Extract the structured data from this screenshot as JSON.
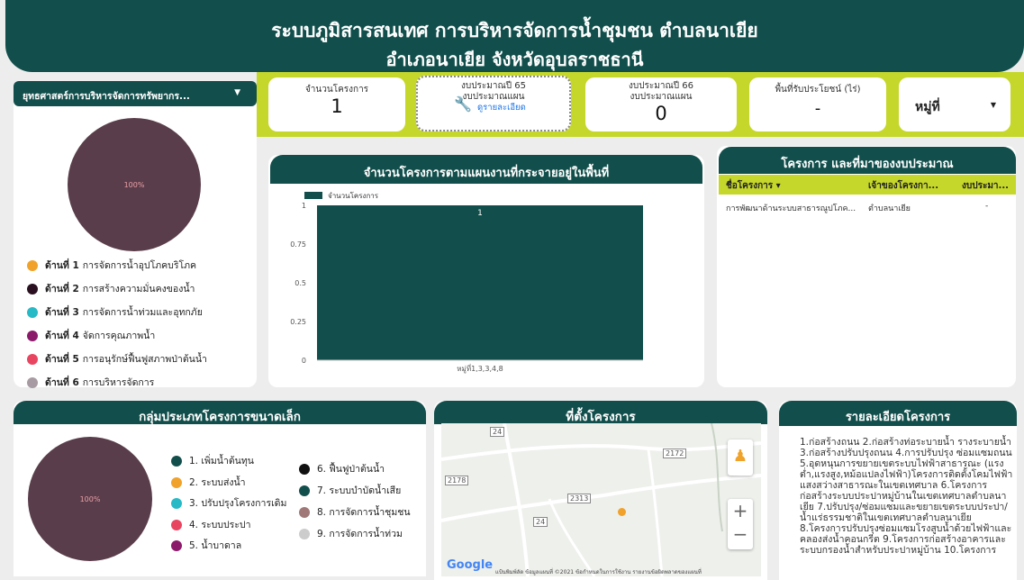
{
  "header": {
    "title_line1": "ระบบภูมิสารสนเทศ การบริหารจัดการน้ำชุมชน ตำบลนาเยีย",
    "title_line2": "อำเภอนาเยีย จังหวัดอุบลราชธานี"
  },
  "strategy_dropdown": {
    "label": "ยุทธศาสตร์การบริหารจัดการทรัพยากร..."
  },
  "kpis": {
    "project_count": {
      "label": "จำนวนโครงการ",
      "value": "1"
    },
    "budget65": {
      "label_line1": "งบประมาณปี 65",
      "label_line2": "งบประมาณแผน",
      "link": "ดูรายละเอียด"
    },
    "budget66": {
      "label_line1": "งบประมาณปี 66",
      "label_line2": "งบประมาณแผน",
      "value": "0"
    },
    "area": {
      "label": "พื้นที่รับประโยชน์ (ไร่)",
      "value": "-"
    },
    "village": {
      "label": "หมู่ที่"
    }
  },
  "pie1": {
    "label": "100%",
    "color": "#5a3d4a"
  },
  "strategy_legend": [
    {
      "bold": "ด้านที่ 1",
      "text": "การจัดการน้ำอุปโภคบริโภค",
      "color": "#f0a22a"
    },
    {
      "bold": "ด้านที่ 2",
      "text": "การสร้างความมั่นคงของน้ำ",
      "color": "#2a1020"
    },
    {
      "bold": "ด้านที่ 3",
      "text": "การจัดการน้ำท่วมและอุทกภัย",
      "color": "#26b9c6"
    },
    {
      "bold": "ด้านที่ 4",
      "text": "จัดการคุณภาพน้ำ",
      "color": "#8c1a6a"
    },
    {
      "bold": "ด้านที่ 5",
      "text": "การอนุรักษ์ฟื้นฟูสภาพป่าต้นน้ำ",
      "color": "#e84560"
    },
    {
      "bold": "ด้านที่ 6",
      "text": "การบริหารจัดการ",
      "color": "#a89aa2"
    }
  ],
  "bar_panel": {
    "title": "จำนวนโครงการตามแผนงานที่กระจายอยู่ในพื้นที่"
  },
  "chart_data": {
    "type": "bar",
    "title": "",
    "legend": "จำนวนโครงการ",
    "categories": [
      "หมู่ที่1,3,3,4,8"
    ],
    "values": [
      1
    ],
    "data_labels": [
      "1"
    ],
    "ylim": [
      0,
      1
    ],
    "yticks": [
      "1",
      "0.75",
      "0.5",
      "0.25",
      "0"
    ],
    "color": "#124f4c"
  },
  "table_panel": {
    "title": "โครงการ และที่มาของงบประมาณ",
    "col1": "ชื่อโครงการ ▾",
    "col2": "เจ้าของโครงกา...",
    "col3": "งบประมา...",
    "rows": [
      {
        "name": "การพัฒนาด้านระบบสาธารณูปโภค...",
        "owner": "ตำบลนาเยีย",
        "budget": "-"
      }
    ]
  },
  "small_projects": {
    "title": "กลุ่มประเภทโครงการขนาดเล็ก",
    "pie_label": "100%",
    "legend_col1": [
      {
        "text": "1. เพิ่มน้ำต้นทุน",
        "color": "#124f4c"
      },
      {
        "text": "2. ระบบส่งน้ำ",
        "color": "#f0a22a"
      },
      {
        "text": "3. ปรับปรุงโครงการเดิม",
        "color": "#26b9c6"
      },
      {
        "text": "4. ระบบประปา",
        "color": "#e84560"
      },
      {
        "text": "5. น้ำบาดาล",
        "color": "#8c1a6a"
      }
    ],
    "legend_col2": [
      {
        "text": "6. ฟื้นฟูป่าต้นน้ำ",
        "color": "#111111"
      },
      {
        "text": "7. ระบบบำบัดน้ำเสีย",
        "color": "#124f4c"
      },
      {
        "text": "8. การจัดการน้ำชุมชน",
        "color": "#a07878"
      },
      {
        "text": "9. การจัดการน้ำท่วม",
        "color": "#cccccc"
      }
    ]
  },
  "map_panel": {
    "title": "ที่ตั้งโครงการ",
    "road_labels": [
      "24",
      "2172",
      "2178",
      "2313",
      "24"
    ],
    "footer": "แป้นพิมพ์ลัด  ข้อมูลแผนที่ ©2021  ข้อกำหนดในการใช้งาน  รายงานข้อผิดพลาดของแผนที่",
    "zoom_in": "+",
    "zoom_out": "−",
    "google": "Google"
  },
  "details_panel": {
    "title": "รายละเอียดโครงการ",
    "text": "1.ก่อสร้างถนน 2.ก่อสร้างท่อระบายน้ำ รางระบายน้ำ 3.ก่อสร้างปรับปรุงถนน 4.การปรับปรุง ซ่อมแซมถนน 5.อุดหนุนการขยายเขตระบบไฟฟ้าสาธารณะ (แรงต่ำ,แรงสูง,หม้อแปลงไฟฟ้า)โครงการติดตั้งโคมไฟฟ้าแสงสว่างสาธารณะในเขตเทศบาล 6.โครงการก่อสร้างระบบประปาหมู่บ้านในเขตเทศบาลตำบลนาเยีย 7.ปรับปรุง/ซ่อมแซมและขยายเขตระบบประปา/น้ำแร่ธรรมชาติในเขตเทศบาลตำบลนาเยีย 8.โครงการปรับปรุงซ่อมแซมโรงสูบน้ำด้วยไฟฟ้าและคลองส่งน้ำคอนกรีต 9.โครงการก่อสร้างอาคารและระบบกรองน้ำสำหรับประปาหมู่บ้าน 10.โครงการ"
  }
}
